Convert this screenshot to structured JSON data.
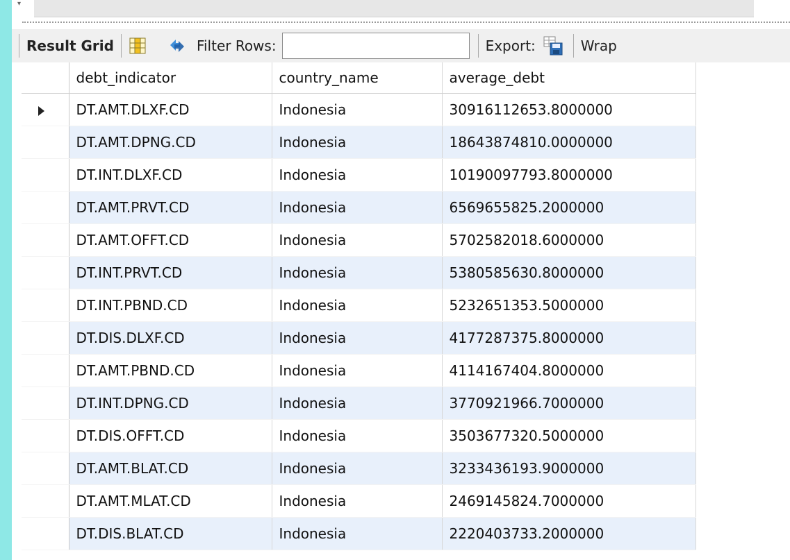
{
  "toolbar": {
    "result_grid": "Result Grid",
    "filter_rows": "Filter Rows:",
    "filter_value": "",
    "export": "Export:",
    "wrap": "Wrap"
  },
  "columns": [
    "debt_indicator",
    "country_name",
    "average_debt"
  ],
  "rows": [
    [
      "DT.AMT.DLXF.CD",
      "Indonesia",
      "30916112653.8000000"
    ],
    [
      "DT.AMT.DPNG.CD",
      "Indonesia",
      "18643874810.0000000"
    ],
    [
      "DT.INT.DLXF.CD",
      "Indonesia",
      "10190097793.8000000"
    ],
    [
      "DT.AMT.PRVT.CD",
      "Indonesia",
      "6569655825.2000000"
    ],
    [
      "DT.AMT.OFFT.CD",
      "Indonesia",
      "5702582018.6000000"
    ],
    [
      "DT.INT.PRVT.CD",
      "Indonesia",
      "5380585630.8000000"
    ],
    [
      "DT.INT.PBND.CD",
      "Indonesia",
      "5232651353.5000000"
    ],
    [
      "DT.DIS.DLXF.CD",
      "Indonesia",
      "4177287375.8000000"
    ],
    [
      "DT.AMT.PBND.CD",
      "Indonesia",
      "4114167404.8000000"
    ],
    [
      "DT.INT.DPNG.CD",
      "Indonesia",
      "3770921966.7000000"
    ],
    [
      "DT.DIS.OFFT.CD",
      "Indonesia",
      "3503677320.5000000"
    ],
    [
      "DT.AMT.BLAT.CD",
      "Indonesia",
      "3233436193.9000000"
    ],
    [
      "DT.AMT.MLAT.CD",
      "Indonesia",
      "2469145824.7000000"
    ],
    [
      "DT.DIS.BLAT.CD",
      "Indonesia",
      "2220403733.2000000"
    ]
  ]
}
